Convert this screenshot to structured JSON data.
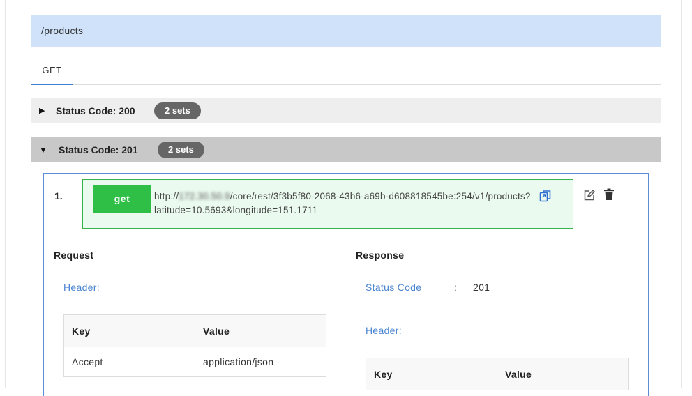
{
  "endpoint": {
    "path": "/products"
  },
  "tabs": [
    {
      "label": "GET"
    }
  ],
  "status_groups": [
    {
      "label": "Status Code: 200",
      "badge": "2 sets",
      "expanded": false
    },
    {
      "label": "Status Code: 201",
      "badge": "2 sets",
      "expanded": true
    }
  ],
  "entry": {
    "index": "1.",
    "method": "get",
    "url_part1": "http://",
    "url_host": "172.30.50.9",
    "url_part2": "/core/rest/3f3b5f80-2068-43b6-a69b-d608818545be:254/v1/products?latitude=10.5693&longitude=151.1711"
  },
  "request": {
    "title": "Request",
    "header_label": "Header:",
    "columns": [
      "Key",
      "Value"
    ],
    "rows": [
      {
        "key": "Accept",
        "value": "application/json"
      }
    ]
  },
  "response": {
    "title": "Response",
    "status_code_label": "Status Code",
    "colon": ":",
    "status_code_value": "201",
    "header_label": "Header:",
    "columns": [
      "Key",
      "Value"
    ]
  },
  "colors": {
    "path_bar": "#cfe2f9",
    "tab_underline": "#3a7fd0",
    "method_green": "#2fbf47",
    "request_box_bg": "#eafaee",
    "link_blue": "#4a84d0",
    "badge_gray": "#666666"
  },
  "icons": [
    "caret-right-icon",
    "caret-down-icon",
    "copy-icon",
    "edit-icon",
    "trash-icon"
  ]
}
